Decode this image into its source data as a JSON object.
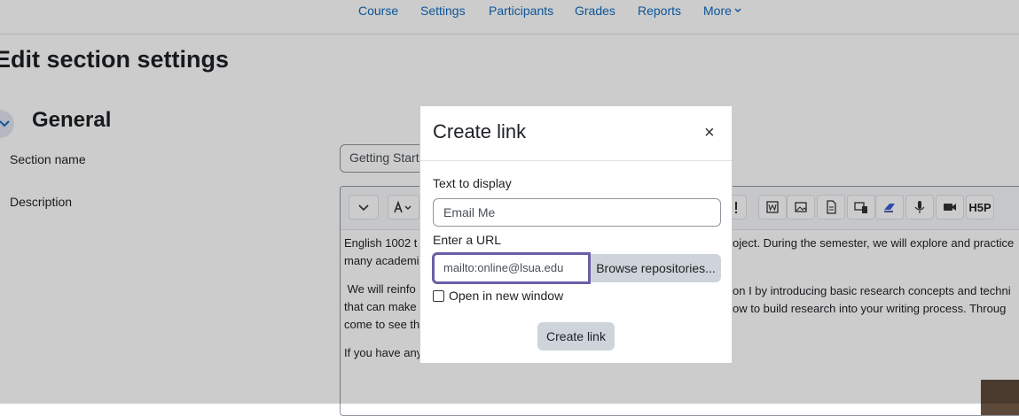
{
  "nav": {
    "items": [
      "Course",
      "Settings",
      "Participants",
      "Grades",
      "Reports"
    ],
    "more_label": "More"
  },
  "page": {
    "title": "Edit section settings",
    "section_heading": "General"
  },
  "form": {
    "section_name_label": "Section name",
    "section_name_value": "Getting Starte",
    "description_label": "Description"
  },
  "editor": {
    "toolbar_icons": [
      "chevron-down-icon",
      "font-icon",
      "word-icon",
      "image-icon",
      "file-icon",
      "media-icon",
      "eraser-icon",
      "microphone-icon",
      "video-icon",
      "h5p-icon"
    ],
    "h5p_label": "H5P",
    "text_lines": [
      "English 1002 t",
      "many academi",
      "We will reinfo",
      "that can make",
      "come to see th",
      "If you have any"
    ],
    "text_lines_right": [
      "oject. During the semester, we will explore and practice",
      "on I by introducing basic research concepts and techni",
      "ow to build research into your writing process. Throug"
    ]
  },
  "modal": {
    "title": "Create link",
    "close_glyph": "×",
    "text_label": "Text to display",
    "text_value": "Email Me",
    "url_label": "Enter a URL",
    "url_value": "mailto:online@lsua.edu",
    "browse_label": "Browse repositories...",
    "new_window_label": "Open in new window",
    "new_window_checked": false,
    "submit_label": "Create link"
  },
  "colors": {
    "link": "#0f6cbf",
    "focus_border": "#6b5ea8",
    "button_bg": "#ced4da"
  }
}
